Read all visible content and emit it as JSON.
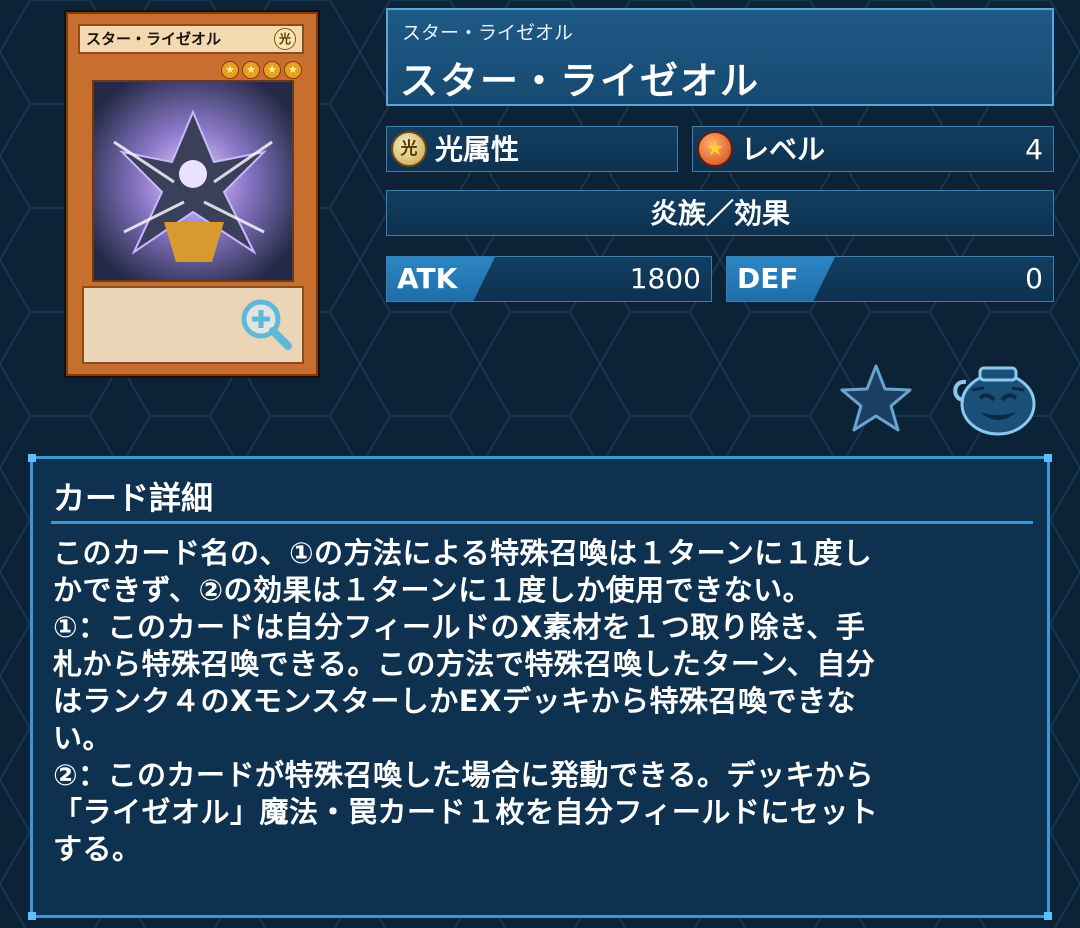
{
  "card": {
    "art_name": "スター・ライゼオル",
    "art_attribute_glyph": "光",
    "level_stars": 4
  },
  "name_box": {
    "ruby": "スター・ライゼオル",
    "name": "スター・ライゼオル"
  },
  "attribute": {
    "icon_glyph": "光",
    "label": "光属性"
  },
  "level": {
    "icon_glyph": "★",
    "label": "レベル",
    "value": "4"
  },
  "type_line": "炎族／効果",
  "atk": {
    "label": "ATK",
    "value": "1800"
  },
  "def": {
    "label": "DEF",
    "value": "0"
  },
  "icons": {
    "favorite": "star-icon",
    "pot": "pot-of-greed-icon",
    "zoom": "zoom-in-icon"
  },
  "colors": {
    "background": "#0c2236",
    "panel_border": "#3b97d8",
    "card_frame": "#c86e2e"
  },
  "detail": {
    "title": "カード詳細",
    "text": "このカード名の、①の方法による特殊召喚は１ターンに１度し\nかできず、②の効果は１ターンに１度しか使用できない。\n①：このカードは自分フィールドのX素材を１つ取り除き、手\n札から特殊召喚できる。この方法で特殊召喚したターン、自分\nはランク４のXモンスターしかEXデッキから特殊召喚できな\nい。\n②：このカードが特殊召喚した場合に発動できる。デッキから\n「ライゼオル」魔法・罠カード１枚を自分フィールドにセット\nする。"
  }
}
